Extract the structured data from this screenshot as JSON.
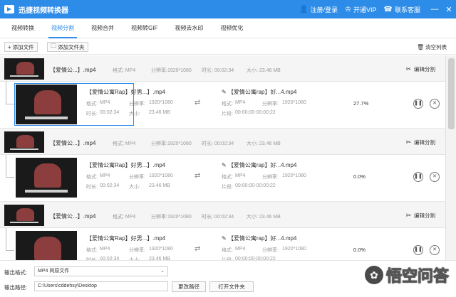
{
  "app": {
    "title": "迅捷视频转换器"
  },
  "header": {
    "login": "注册/登录",
    "vip": "开通VIP",
    "support": "联系客服"
  },
  "tabs": [
    {
      "label": "视频转换"
    },
    {
      "label": "视频分割"
    },
    {
      "label": "视频合并"
    },
    {
      "label": "视频转GIF"
    },
    {
      "label": "视频去水印"
    },
    {
      "label": "视频优化"
    }
  ],
  "toolbar": {
    "add_file": "添加文件",
    "add_folder": "添加文件夹",
    "clear_list": "清空列表"
  },
  "labels": {
    "format": "格式: MP4",
    "resolution": "分辨率:1920*1080",
    "duration": "时长: 00:02:34",
    "size": "大小: 23.46 MB",
    "edit_split": "编辑分割",
    "seg_format_key": "格式:",
    "seg_format_val": "MP4",
    "seg_res_key": "分辨率:",
    "seg_res_val": "1920*1080",
    "seg_dur_key": "时长:",
    "seg_dur_val": "00:02:34",
    "seg_size_key": "大小:",
    "seg_size_val": "23.46 MB",
    "out_cut_key": "片段:",
    "out_cut_val": "00:00:00-00:00:22"
  },
  "groups": [
    {
      "name": "【爱情公...】.mp4"
    },
    {
      "name": "【爱情公...】.mp4"
    },
    {
      "name": "【爱情公...】.mp4"
    },
    {
      "name": "【爱情公...】.mp4"
    }
  ],
  "segments": [
    {
      "name": "【爱情公寓Rap】好男...】.mp4",
      "output": "【爱情公寓rap】好...4.mp4",
      "progress": "27.7%"
    },
    {
      "name": "【爱情公寓Rap】好男...】.mp4",
      "output": "【爱情公寓rap】好...4.mp4",
      "progress": "0.0%"
    },
    {
      "name": "【爱情公寓Rap】好男...】.mp4",
      "output": "【爱情公寓rap】好...4.mp4",
      "progress": "0.0%"
    }
  ],
  "bottom": {
    "format_label": "输出格式:",
    "format_value": "MP4  同原文件",
    "path_label": "输出路径:",
    "path_value": "C:\\Users\\cddehsy\\Desktop",
    "change_path": "更改路径",
    "open_folder": "打开文件夹"
  },
  "watermark": {
    "text": "悟空问答"
  },
  "colors": {
    "accent": "#2d8ce8"
  }
}
